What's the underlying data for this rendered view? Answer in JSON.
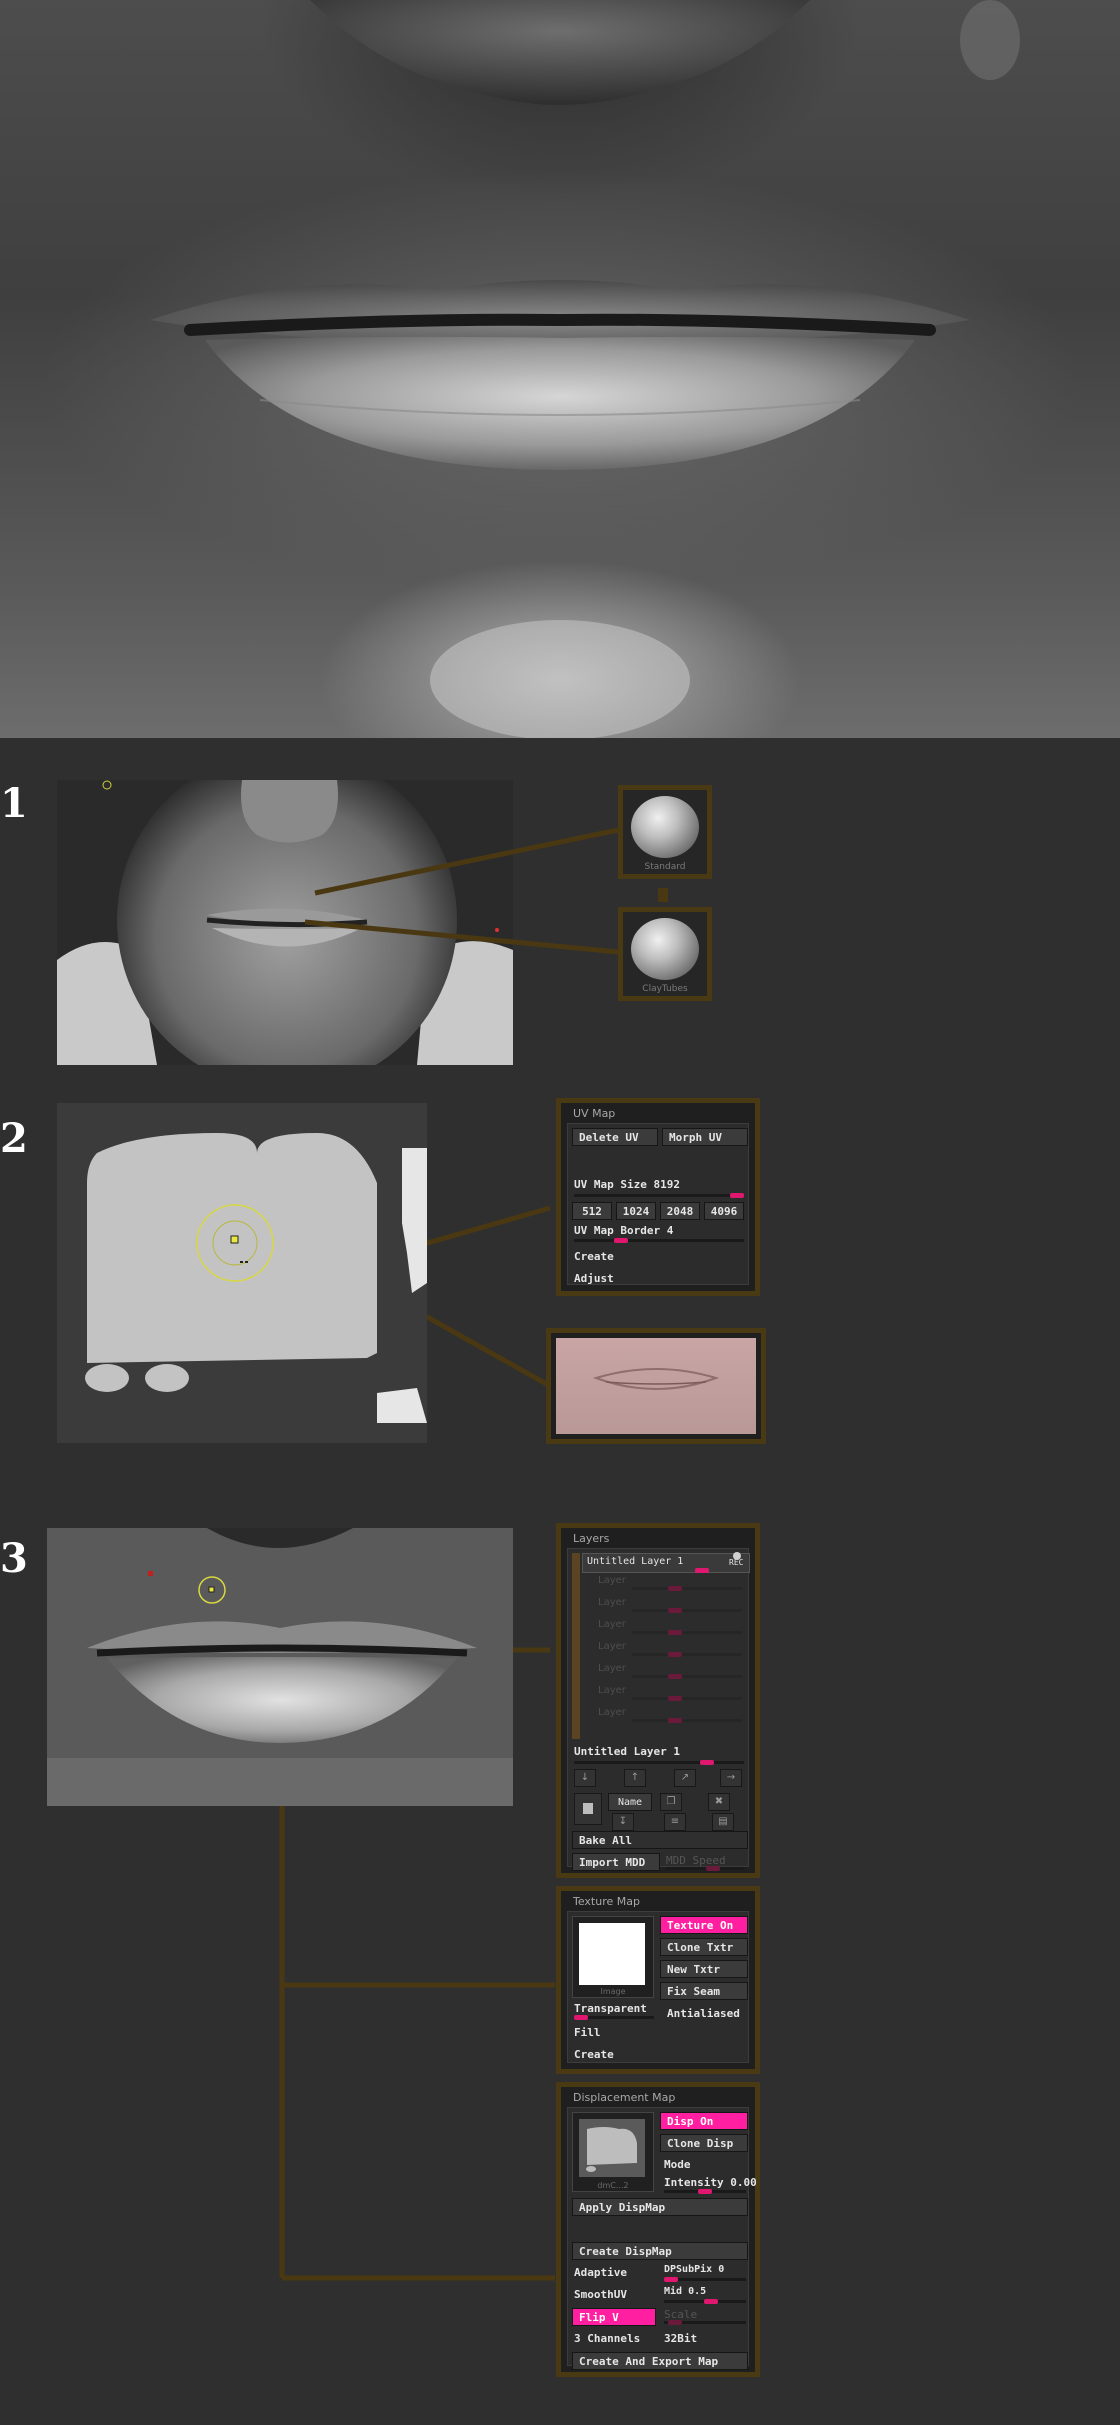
{
  "sections": [
    "1",
    "2",
    "3"
  ],
  "brushes": [
    {
      "label": "Standard",
      "icon": "standard-brush-icon"
    },
    {
      "label": "ClayTubes",
      "icon": "claytubes-brush-icon"
    }
  ],
  "uv_map": {
    "title": "UV Map",
    "delete_uv": "Delete UV",
    "morph_uv": "Morph UV",
    "size_label": "UV Map Size",
    "size_value": "8192",
    "size_value_fraction": 1.0,
    "sizes": [
      "512",
      "1024",
      "2048",
      "4096"
    ],
    "border_label": "UV Map Border",
    "border_value": "4",
    "create": "Create",
    "adjust": "Adjust"
  },
  "layers": {
    "title": "Layers",
    "active_layer": "Untitled Layer 1",
    "rec_label": "REC",
    "empty_slots": [
      "Layer",
      "Layer",
      "Layer",
      "Layer",
      "Layer",
      "Layer",
      "Layer"
    ],
    "current_layer_label": "Untitled Layer 1",
    "name_button": "Name",
    "bake_all": "Bake All",
    "import_mdd": "Import MDD",
    "mdd_speed": "MDD Speed"
  },
  "texture_map": {
    "title": "Texture Map",
    "texture_on": "Texture On",
    "clone_txtr": "Clone Txtr",
    "new_txtr": "New Txtr",
    "fix_seam": "Fix Seam",
    "antialiased": "Antialiased",
    "transparent": "Transparent",
    "image_caption": "Image",
    "fill": "Fill",
    "create": "Create"
  },
  "displacement_map": {
    "title": "Displacement Map",
    "disp_on": "Disp On",
    "clone_disp": "Clone Disp",
    "mode": "Mode",
    "intensity_label": "Intensity",
    "intensity_value": "0.00",
    "thumb_caption": "dmC...2",
    "apply_dispmap": "Apply DispMap",
    "create_dispmap": "Create DispMap",
    "adaptive": "Adaptive",
    "dpsubpix_label": "DPSubPix",
    "dpsubpix_value": "0",
    "smoothuv": "SmoothUV",
    "mid_label": "Mid",
    "mid_value": "0.5",
    "flip_v": "Flip V",
    "scale": "Scale",
    "channels": "3 Channels",
    "bits": "32Bit",
    "create_export": "Create And Export Map"
  },
  "colors": {
    "background": "#2f2f2f",
    "accent_pink": "#ff1fa0",
    "connector_brown": "#4a3812",
    "cursor_yellow": "#e0e040"
  }
}
